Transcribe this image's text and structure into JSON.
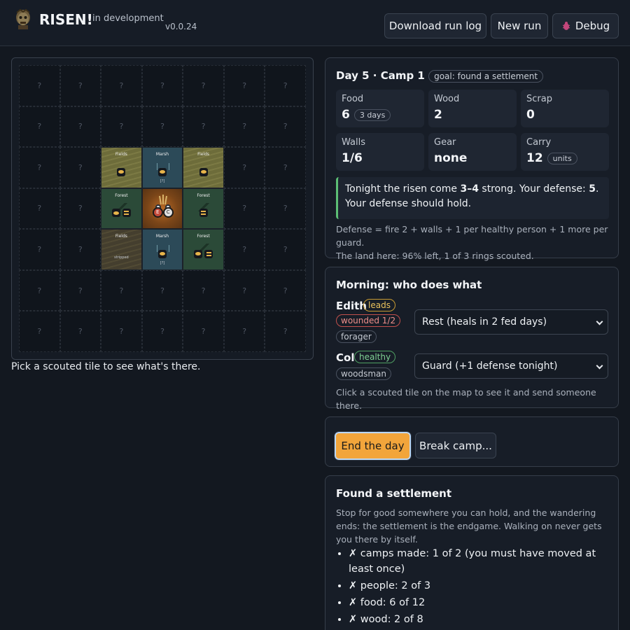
{
  "header": {
    "title": "RISEN!",
    "subtitle": "in development",
    "version": "v0.0.24",
    "download_label": "Download run log",
    "newrun_label": "New run",
    "debug_label": "Debug"
  },
  "map": {
    "unknown": "?",
    "tiles": {
      "r2c2": {
        "name": "Fields"
      },
      "r2c3": {
        "name": "Marsh",
        "note": "[?]"
      },
      "r2c4": {
        "name": "Fields"
      },
      "r3c2": {
        "name": "Forest"
      },
      "r3c3": {
        "camp_a": "E",
        "camp_b": "C"
      },
      "r3c4": {
        "name": "Forest"
      },
      "r4c2": {
        "name": "Fields",
        "note": "stripped"
      },
      "r4c3": {
        "name": "Marsh",
        "note": "[?]"
      },
      "r4c4": {
        "name": "Forest"
      }
    },
    "hint": "Pick a scouted tile to see what's there."
  },
  "status": {
    "title": "Day 5 · Camp 1",
    "goal": "goal: found a settlement",
    "food": {
      "label": "Food",
      "value": "6",
      "badge": "3 days"
    },
    "wood": {
      "label": "Wood",
      "value": "2"
    },
    "scrap": {
      "label": "Scrap",
      "value": "0"
    },
    "walls": {
      "label": "Walls",
      "value": "1/6"
    },
    "gear": {
      "label": "Gear",
      "value": "none"
    },
    "carry": {
      "label": "Carry",
      "value": "12",
      "badge": "units"
    },
    "warning_pre": "Tonight the risen come ",
    "warning_strength": "3–4",
    "warning_mid": " strong. Your defense: ",
    "warning_defense": "5",
    "warning_post": ". Your defense should hold.",
    "defense_note": "Defense = fire 2 + walls + 1 per healthy person + 1 more per guard.",
    "land_note": "The land here: 96% left, 1 of 3 rings scouted."
  },
  "morning": {
    "title": "Morning: who does what",
    "people": [
      {
        "name": "Edith",
        "tags": [
          "leads",
          "wounded 1/2",
          "forager"
        ],
        "task": "Rest (heals in 2 fed days)"
      },
      {
        "name": "Col",
        "tags": [
          "healthy",
          "woodsman"
        ],
        "task": "Guard (+1 defense tonight)"
      }
    ],
    "note": "Click a scouted tile on the map to see it and send someone there."
  },
  "actions": {
    "end_day": "End the day",
    "break_camp": "Break camp..."
  },
  "goal": {
    "title": "Found a settlement",
    "text": "Stop for good somewhere you can hold, and the wandering ends: the settlement is the endgame. Walking on never gets you there by itself.",
    "checks": [
      "✗ camps made: 1 of 2 (you must have moved at least once)",
      "✗ people: 2 of 3",
      "✗ food: 6 of 12",
      "✗ wood: 2 of 8"
    ]
  },
  "colors": {
    "accent": "#f2a53b",
    "healthy": "#7fd193",
    "wounded": "#ee8f8a",
    "leads": "#e9c15c"
  }
}
